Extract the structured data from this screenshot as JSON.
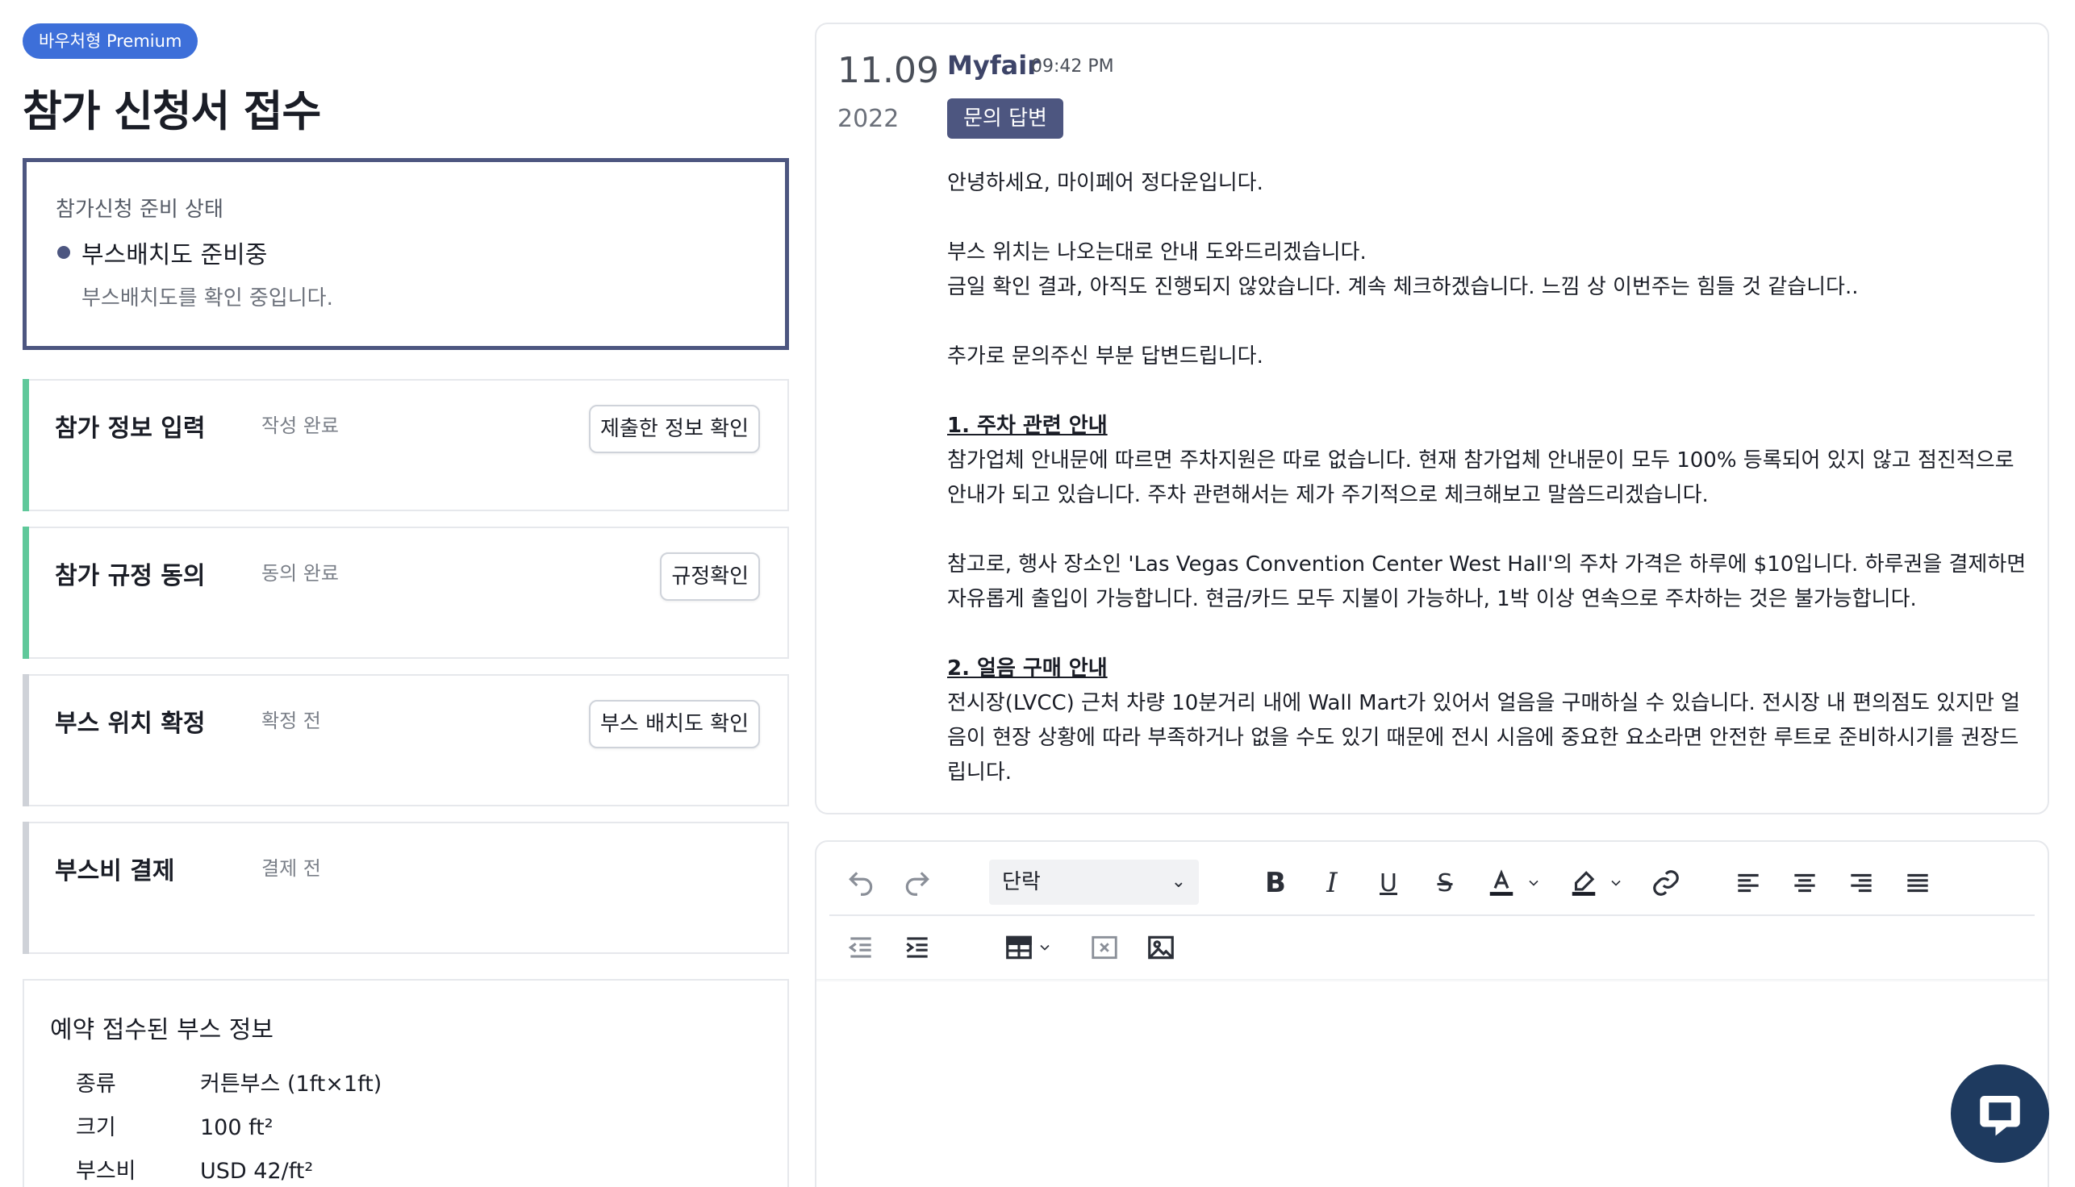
{
  "header": {
    "badge": "바우처형 Premium",
    "title": "참가 신청서 접수"
  },
  "status": {
    "label": "참가신청 준비 상태",
    "value": "부스배치도 준비중",
    "description": "부스배치도를 확인 중입니다."
  },
  "steps": [
    {
      "title": "참가 정보 입력",
      "status": "작성 완료",
      "button": "제출한 정보 확인",
      "done": true
    },
    {
      "title": "참가 규정 동의",
      "status": "동의 완료",
      "button": "규정확인",
      "done": true
    },
    {
      "title": "부스 위치 확정",
      "status": "확정 전",
      "button": "부스 배치도 확인",
      "done": false
    },
    {
      "title": "부스비 결제",
      "status": "결제 전",
      "button": "",
      "done": false
    }
  ],
  "booth": {
    "title": "예약 접수된 부스 정보",
    "rows": [
      {
        "key": "종류",
        "value": "커튼부스 (1ft×1ft)"
      },
      {
        "key": "크기",
        "value": "100 ft²"
      },
      {
        "key": "부스비",
        "value": "USD 42/ft²"
      }
    ]
  },
  "message": {
    "day": "11.09",
    "year": "2022",
    "sender": "Myfair",
    "time": "09:42 PM",
    "tag": "문의 답변",
    "greeting": "안녕하세요, 마이페어 정다운입니다.",
    "p2_line1": "부스 위치는 나오는대로 안내 도와드리겠습니다.",
    "p2_line2": "금일 확인 결과, 아직도 진행되지 않았습니다. 계속 체크하겠습니다. 느낌 상 이번주는 힘들 것 같습니다..",
    "p3": "추가로 문의주신 부분 답변드립니다.",
    "section1_heading": "1. 주차 관련 안내",
    "section1_body": "참가업체 안내문에 따르면 주차지원은 따로 없습니다. 현재 참가업체 안내문이 모두 100% 등록되어 있지 않고 점진적으로 안내가 되고 있습니다. 주차 관련해서는 제가 주기적으로 체크해보고 말씀드리겠습니다.",
    "section1_note": "참고로, 행사 장소인 'Las Vegas Convention Center West Hall'의 주차 가격은 하루에 $10입니다. 하루권을 결제하면 자유롭게 출입이 가능합니다. 현금/카드 모두 지불이 가능하나, 1박 이상 연속으로 주차하는 것은 불가능합니다.",
    "section2_heading": "2. 얼음 구매 안내",
    "section2_body": "전시장(LVCC) 근처 차량 10분거리 내에 Wall Mart가 있어서 얼음을 구매하실 수 있습니다. 전시장 내 편의점도 있지만 얼음이 현장 상황에 따라 부족하거나 없을 수도 있기 때문에 전시 시음에 중요한 요소라면 안전한 루트로 준비하시기를 권장드립니다."
  },
  "editor": {
    "paragraph_select": "단락"
  },
  "colors": {
    "accent": "#4d5680",
    "badge": "#3d6fd9",
    "done_bar": "#5fc89a",
    "chat_button": "#1e3a5f"
  },
  "icons": [
    "undo-icon",
    "redo-icon",
    "chevron-down-icon",
    "bold-icon",
    "italic-icon",
    "underline-icon",
    "strikethrough-icon",
    "font-color-icon",
    "highlight-icon",
    "link-icon",
    "align-left-icon",
    "align-center-icon",
    "align-right-icon",
    "align-justify-icon",
    "outdent-icon",
    "indent-icon",
    "table-icon",
    "remove-format-icon",
    "image-icon",
    "chat-icon"
  ]
}
